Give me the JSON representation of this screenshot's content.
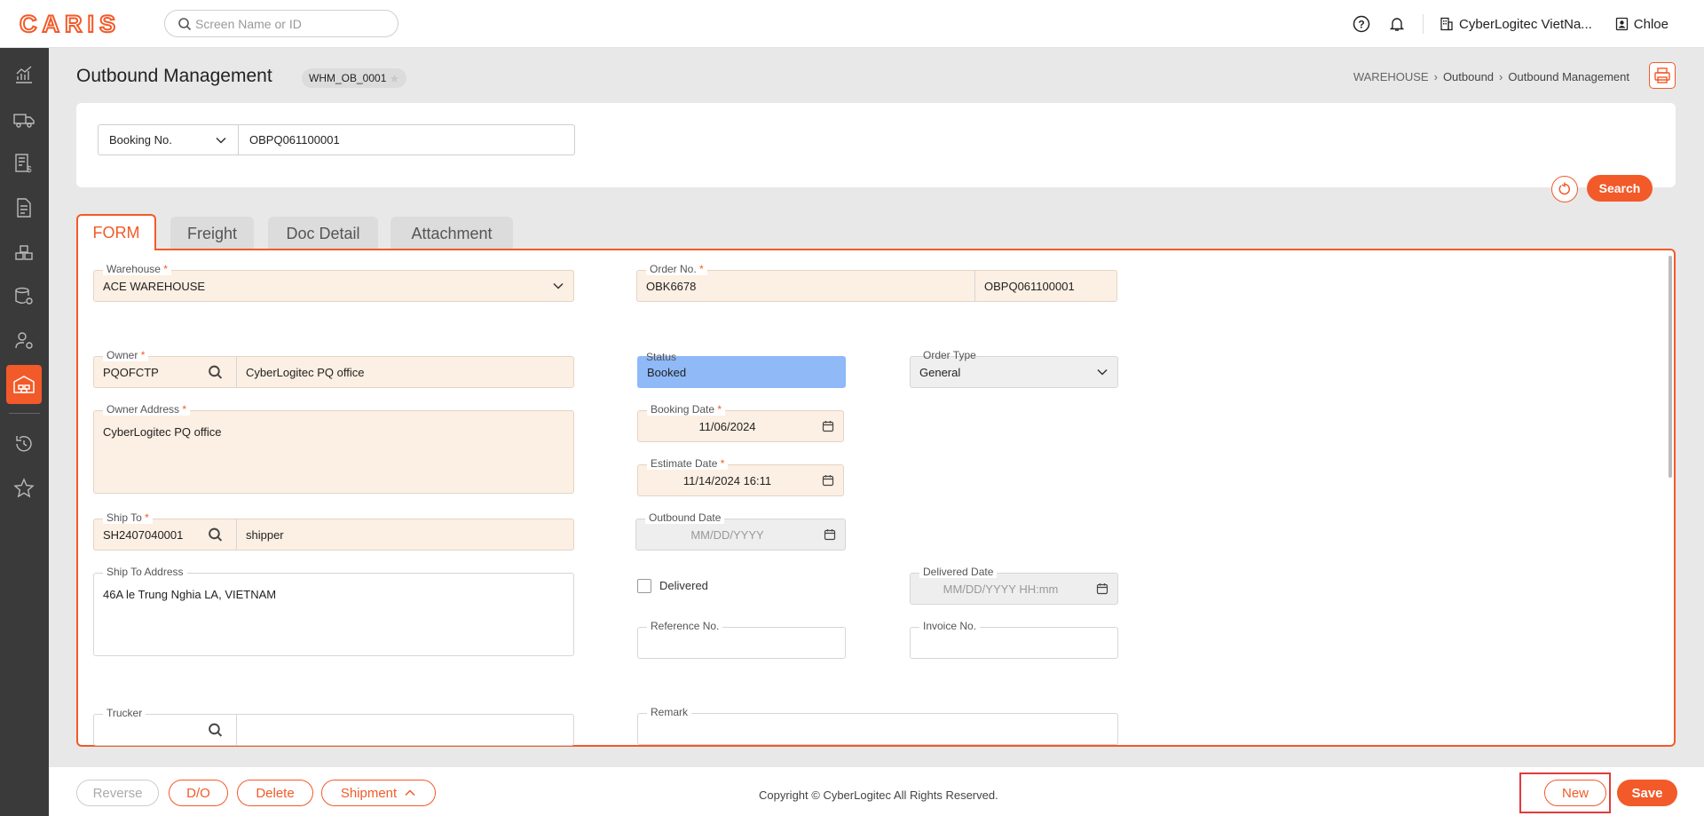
{
  "app": {
    "logo": "CARIS",
    "brand_color": "#f25a29"
  },
  "header": {
    "search_placeholder": "Screen Name or ID",
    "company": "CyberLogitec VietNa...",
    "user": "Chloe"
  },
  "sidebar": {
    "items": [
      "dashboard-icon",
      "truck-icon",
      "billing-icon",
      "document-icon",
      "boxes-icon",
      "database-settings-icon",
      "user-settings-icon",
      "warehouse-icon",
      "history-icon",
      "star-icon"
    ],
    "active": "warehouse-icon"
  },
  "page": {
    "title": "Outbound Management",
    "screen_id": "WHM_OB_0001",
    "breadcrumb": [
      "WAREHOUSE",
      "Outbound",
      "Outbound Management"
    ]
  },
  "search": {
    "select_value": "Booking No.",
    "input_value": "OBPQ061100001",
    "search_label": "Search"
  },
  "tabs": [
    {
      "label": "FORM",
      "active": true
    },
    {
      "label": "Freight",
      "active": false
    },
    {
      "label": "Doc Detail",
      "active": false
    },
    {
      "label": "Attachment",
      "active": false
    }
  ],
  "form": {
    "warehouse": {
      "label": "Warehouse",
      "value": "ACE WAREHOUSE"
    },
    "order_no": {
      "label": "Order No.",
      "value": "OBK6678",
      "value2": "OBPQ061100001"
    },
    "owner": {
      "label": "Owner",
      "code": "PQOFCTP",
      "name": "CyberLogitec PQ office"
    },
    "status": {
      "label": "Status",
      "value": "Booked"
    },
    "order_type": {
      "label": "Order Type",
      "value": "General"
    },
    "owner_address": {
      "label": "Owner Address",
      "value": "CyberLogitec PQ office"
    },
    "booking_date": {
      "label": "Booking Date",
      "value": "11/06/2024"
    },
    "estimate_date": {
      "label": "Estimate Date",
      "value": "11/14/2024 16:11"
    },
    "ship_to": {
      "label": "Ship To",
      "code": "SH2407040001",
      "name": "shipper"
    },
    "outbound_date": {
      "label": "Outbound Date",
      "placeholder": "MM/DD/YYYY"
    },
    "ship_to_address": {
      "label": "Ship To Address",
      "value": "46A le Trung Nghia LA, VIETNAM"
    },
    "delivered": {
      "label": "Delivered",
      "checked": false
    },
    "delivered_date": {
      "label": "Delivered Date",
      "placeholder": "MM/DD/YYYY HH:mm"
    },
    "reference_no": {
      "label": "Reference No.",
      "value": ""
    },
    "invoice_no": {
      "label": "Invoice No.",
      "value": ""
    },
    "trucker": {
      "label": "Trucker",
      "code": "",
      "name": ""
    },
    "remark": {
      "label": "Remark",
      "value": ""
    }
  },
  "footer": {
    "buttons": {
      "reverse": "Reverse",
      "do": "D/O",
      "delete": "Delete",
      "shipment": "Shipment",
      "new": "New",
      "save": "Save"
    },
    "copyright": "Copyright © CyberLogitec All Rights Reserved."
  }
}
